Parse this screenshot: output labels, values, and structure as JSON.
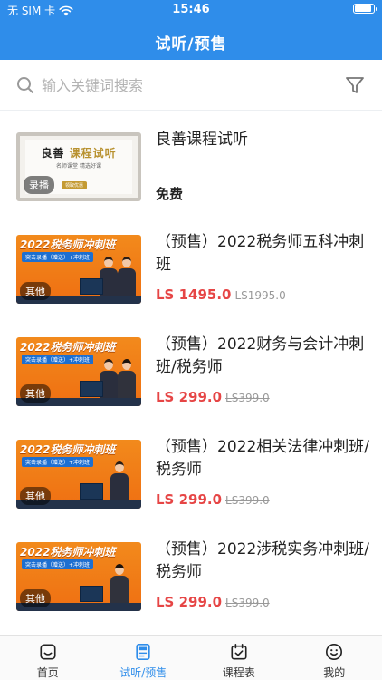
{
  "status_bar": {
    "carrier": "无 SIM 卡",
    "time": "15:46",
    "battery_level": 0.95
  },
  "nav": {
    "title": "试听/预售"
  },
  "search": {
    "placeholder": "输入关键词搜索"
  },
  "colors": {
    "primary": "#2f8dea",
    "price": "#e64545",
    "badge_gold": "#c49a32"
  },
  "courses": [
    {
      "title": "良善课程试听",
      "free_label": "免费",
      "badge": "录播",
      "thumb": {
        "headline_a": "良善",
        "headline_b": "课程试听",
        "subline": "名师课堂   精选好课",
        "pill": "领取优惠"
      }
    },
    {
      "title": "（预售）2022税务师五科冲刺班",
      "price": "LS 1495.0",
      "original_price": "LS1995.0",
      "badge": "其他",
      "thumb": {
        "headline": "2022税务师冲刺班",
        "subline": "突击录播（赠送）+冲刺班"
      }
    },
    {
      "title": "（预售）2022财务与会计冲刺班/税务师",
      "price": "LS 299.0",
      "original_price": "LS399.0",
      "badge": "其他",
      "thumb": {
        "headline": "2022税务师冲刺班",
        "subline": "突击录播（赠送）+冲刺班"
      }
    },
    {
      "title": "（预售）2022相关法律冲刺班/税务师",
      "price": "LS 299.0",
      "original_price": "LS399.0",
      "badge": "其他",
      "thumb": {
        "headline": "2022税务师冲刺班",
        "subline": "突击录播（赠送）+冲刺班"
      }
    },
    {
      "title": "（预售）2022涉税实务冲刺班/税务师",
      "price": "LS 299.0",
      "original_price": "LS399.0",
      "badge": "其他",
      "thumb": {
        "headline": "2022税务师冲刺班",
        "subline": "突击录播（赠送）+冲刺班"
      }
    }
  ],
  "tabs": [
    {
      "label": "首页",
      "icon": "home-icon"
    },
    {
      "label": "试听/预售",
      "icon": "document-icon",
      "active": true
    },
    {
      "label": "课程表",
      "icon": "calendar-check-icon"
    },
    {
      "label": "我的",
      "icon": "smiley-icon"
    }
  ]
}
